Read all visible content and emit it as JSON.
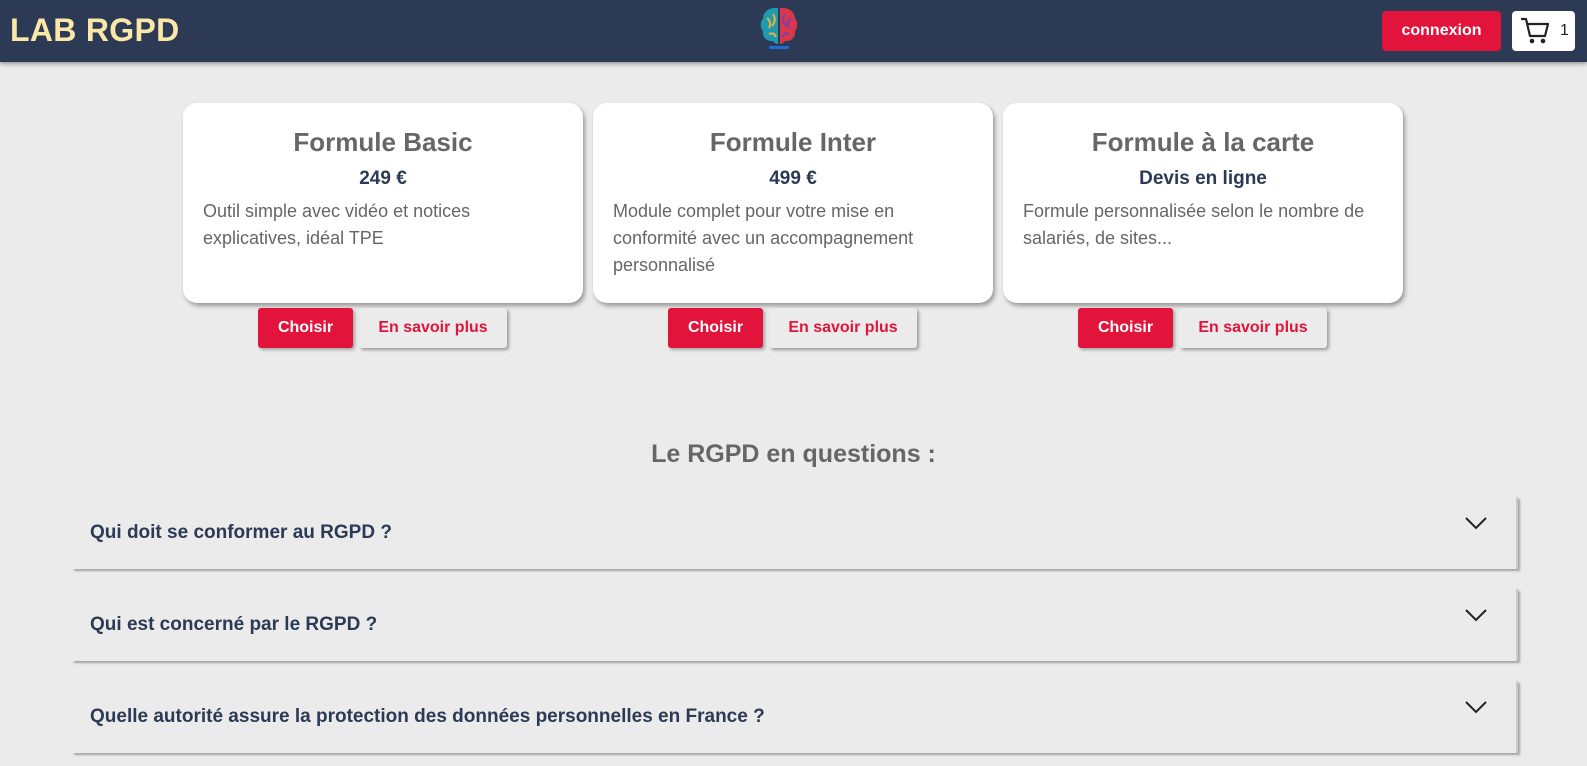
{
  "header": {
    "brand": "LAB RGPD",
    "login_label": "connexion",
    "cart_count": "1",
    "colors": {
      "background": "#2c3a55",
      "brand": "#fbe7a8",
      "accent": "#e3143b"
    }
  },
  "offers": [
    {
      "title": "Formule Basic",
      "price": "249 €",
      "description": "Outil simple avec vidéo et notices explicatives, idéal TPE",
      "choose_label": "Choisir",
      "more_label": "En savoir plus"
    },
    {
      "title": "Formule Inter",
      "price": "499 €",
      "description": "Module complet pour votre mise en conformité avec un accompagnement personnalisé",
      "choose_label": "Choisir",
      "more_label": "En savoir plus"
    },
    {
      "title": "Formule à la carte",
      "price": "Devis en ligne",
      "description": "Formule personnalisée selon le nombre de salariés, de sites...",
      "choose_label": "Choisir",
      "more_label": "En savoir plus"
    }
  ],
  "faq": {
    "heading": "Le RGPD en questions :",
    "items": [
      {
        "question": "Qui doit se conformer au RGPD ?",
        "icon": "chevron-down-icon"
      },
      {
        "question": "Qui est concerné par le RGPD ?",
        "icon": "chevron-down-icon"
      },
      {
        "question": "Quelle autorité assure la protection des données personnelles en France ?",
        "icon": "chevron-down-icon"
      }
    ]
  }
}
